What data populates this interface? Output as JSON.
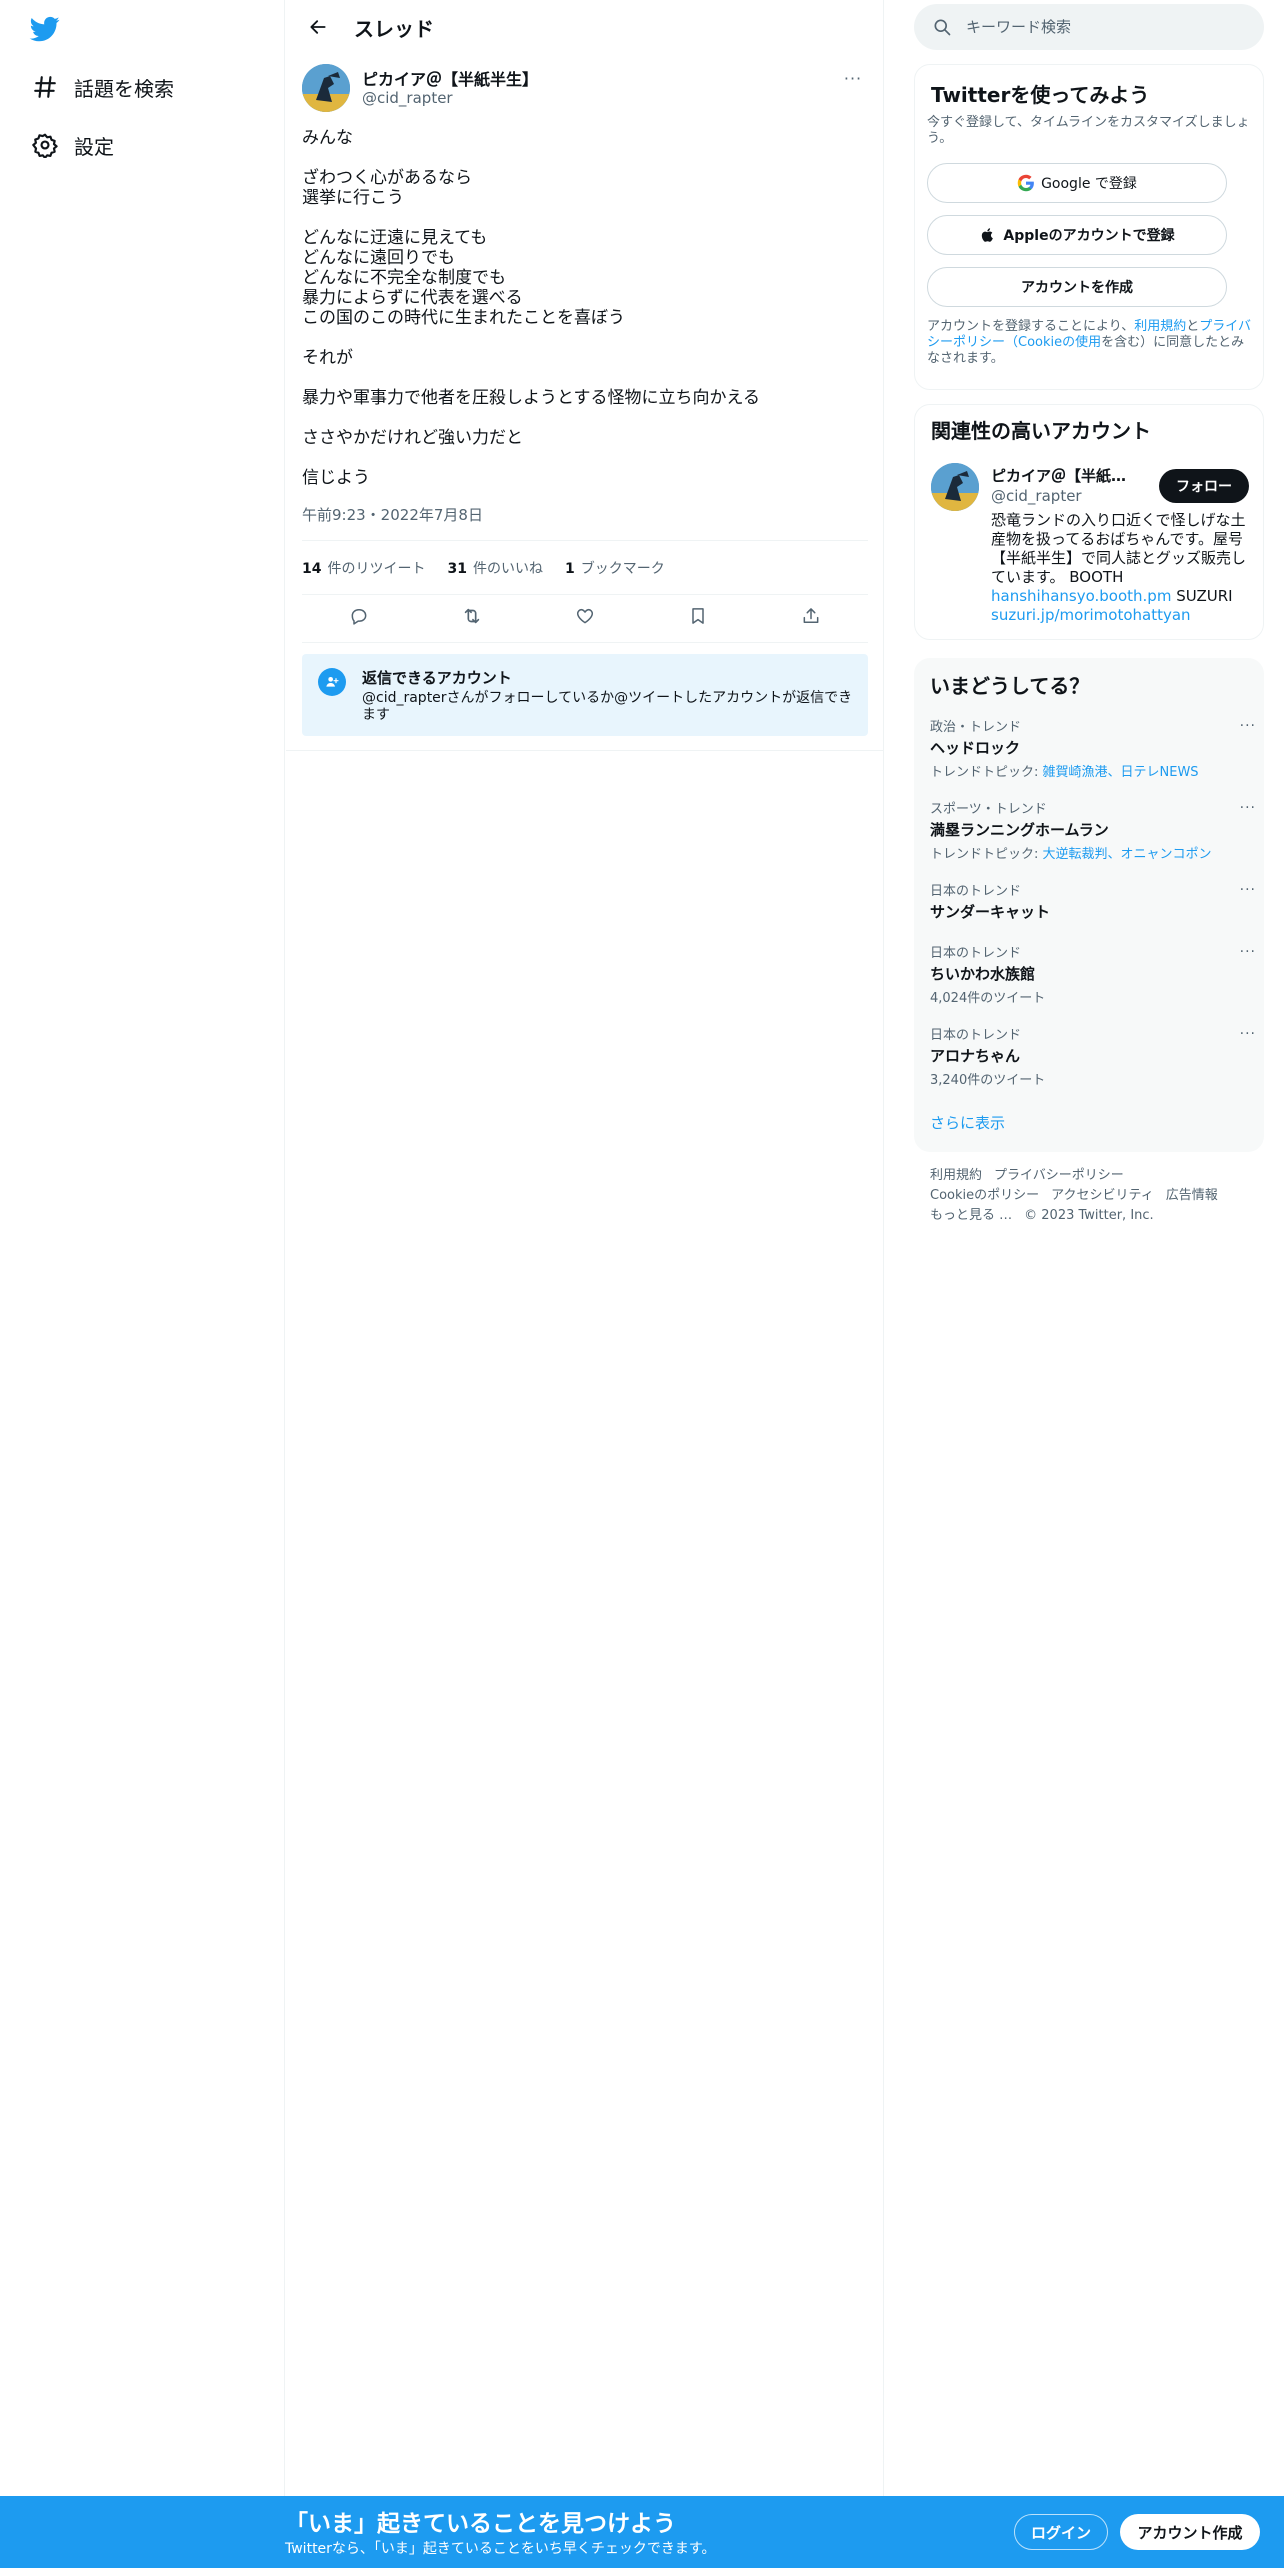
{
  "nav": {
    "items": [
      {
        "label": "話題を検索",
        "icon": "hashtag-icon"
      },
      {
        "label": "設定",
        "icon": "gear-icon"
      }
    ]
  },
  "header": {
    "title": "スレッド"
  },
  "tweet": {
    "author_name": "ピカイア＠【半紙半生】",
    "author_handle": "@cid_rapter",
    "paragraphs": [
      [
        "みんな"
      ],
      [
        "ざわつく心があるなら",
        "選挙に行こう"
      ],
      [
        "どんなに迂遠に見えても",
        "どんなに遠回りでも",
        "どんなに不完全な制度でも",
        "暴力によらずに代表を選べる",
        "この国のこの時代に生まれたことを喜ぼう"
      ],
      [
        "それが"
      ],
      [
        "暴力や軍事力で他者を圧殺しようとする怪物に立ち向かえる"
      ],
      [
        "ささやかだけれど強い力だと"
      ],
      [
        "信じよう"
      ]
    ],
    "timestamp": "午前9:23・2022年7月8日",
    "stats": {
      "retweets_count": "14",
      "retweets_label": "件のリツイート",
      "likes_count": "31",
      "likes_label": "件のいいね",
      "bookmarks_count": "1",
      "bookmarks_label": "ブックマーク"
    }
  },
  "reply_restriction": {
    "title": "返信できるアカウント",
    "text": "@cid_rapterさんがフォローしているか@ツイートしたアカウントが返信できます"
  },
  "search": {
    "placeholder": "キーワード検索"
  },
  "signup_card": {
    "title": "Twitterを使ってみよう",
    "subtitle": "今すぐ登録して、タイムラインをカスタマイズしましょう。",
    "google_label": "Google で登録",
    "apple_label": "Appleのアカウントで登録",
    "create_label": "アカウントを作成",
    "terms_prefix": "アカウントを登録することにより、",
    "terms_link": "利用規約",
    "terms_and": "と",
    "privacy_link": "プライバシーポリシー",
    "cookie_open": "（",
    "cookie_link": "Cookieの使用",
    "terms_suffix": "を含む）に同意したとみなされます。"
  },
  "related_card": {
    "title": "関連性の高いアカウント",
    "name": "ピカイア＠【半紙半生】",
    "handle": "@cid_rapter",
    "follow_label": "フォロー",
    "bio_text": "恐竜ランドの入り口近くで怪しげな土産物を扱ってるおばちゃんです。屋号【半紙半生】で同人誌とグッズ販売しています。 BOOTH",
    "bio_link1": "hanshihansyo.booth.pm",
    "bio_mid": " SUZURI",
    "bio_link2": "suzuri.jp/morimotohattyan"
  },
  "trends_card": {
    "title": "いまどうしてる？",
    "items": [
      {
        "context": "政治・トレンド",
        "name": "ヘッドロック",
        "sub_prefix": "トレンドトピック: ",
        "sub_link": "雑賀崎漁港、日テレNEWS"
      },
      {
        "context": "スポーツ・トレンド",
        "name": "満塁ランニングホームラン",
        "sub_prefix": "トレンドトピック: ",
        "sub_link": "大逆転裁判、オニャンコポン"
      },
      {
        "context": "日本のトレンド",
        "name": "サンダーキャット",
        "sub_prefix": "",
        "sub_link": ""
      },
      {
        "context": "日本のトレンド",
        "name": "ちいかわ水族館",
        "sub_prefix": "4,024件のツイート",
        "sub_link": ""
      },
      {
        "context": "日本のトレンド",
        "name": "アロナちゃん",
        "sub_prefix": "3,240件のツイート",
        "sub_link": ""
      }
    ],
    "more_glyph": "···",
    "show_more": "さらに表示"
  },
  "footer": {
    "links": [
      "利用規約",
      "プライバシーポリシー",
      "Cookieのポリシー",
      "アクセシビリティ",
      "広告情報",
      "もっと見る …",
      "© 2023 Twitter, Inc."
    ]
  },
  "bottom_bar": {
    "title": "「いま」起きていることを見つけよう",
    "subtitle": "Twitterなら、「いま」起きていることをいち早くチェックできます。",
    "login_label": "ログイン",
    "signup_label": "アカウント作成"
  },
  "colors": {
    "accent": "#1d9bf0",
    "text": "#0f1419",
    "muted": "#536471",
    "border": "#eff3f4"
  }
}
